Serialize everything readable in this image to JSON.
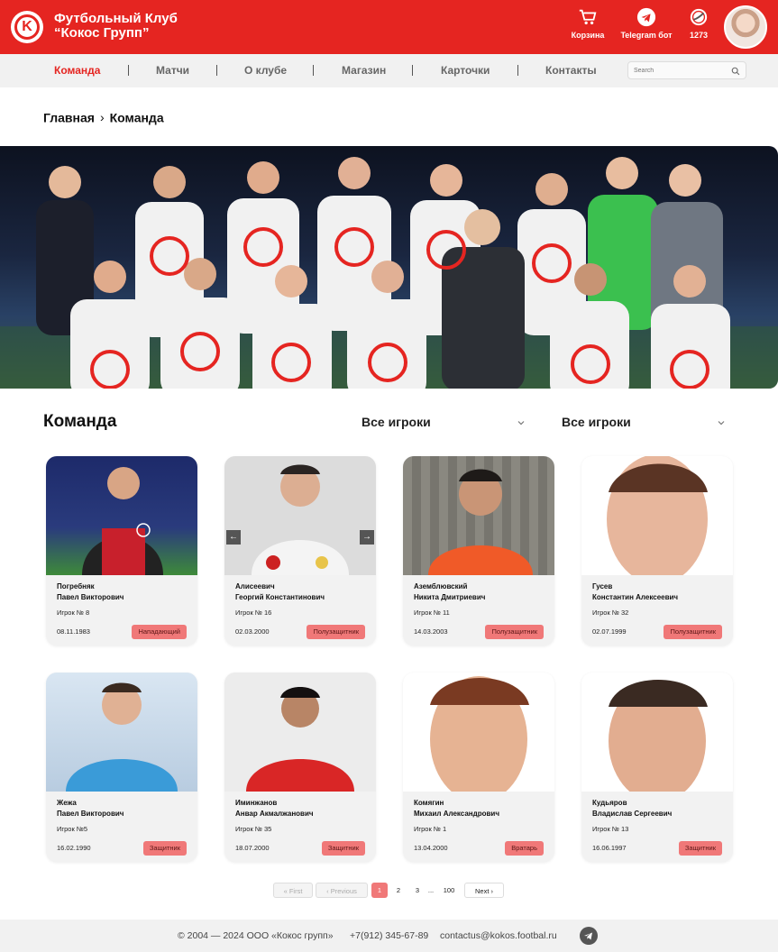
{
  "header": {
    "club_name": "Футбольный Клуб\n“Кокос Групп”",
    "logo_letter": "K",
    "cart_label": "Корзина",
    "telegram_label": "Telegram бот",
    "coins_label": "1273"
  },
  "nav": {
    "items": [
      "Команда",
      "Матчи",
      "О клубе",
      "Магазин",
      "Карточки",
      "Контакты"
    ],
    "search_placeholder": "Search"
  },
  "breadcrumb": {
    "home": "Главная",
    "current": "Команда"
  },
  "team": {
    "title": "Команда",
    "filter1": "Все игроки",
    "filter2": "Все игроки"
  },
  "players": [
    {
      "last": "Погребняк",
      "first": "Павел Викторович",
      "number": "Игрок № 8",
      "dob": "08.11.1983",
      "position": "Нападающий"
    },
    {
      "last": "Алисеевич",
      "first": "Георгий Константинович",
      "number": "Игрок № 16",
      "dob": "02.03.2000",
      "position": "Полузащитник"
    },
    {
      "last": "Аземблювский",
      "first": "Никита Дмитриевич",
      "number": "Игрок № 11",
      "dob": "14.03.2003",
      "position": "Полузащитник"
    },
    {
      "last": "Гусев",
      "first": "Константин Алексеевич",
      "number": "Игрок № 32",
      "dob": "02.07.1999",
      "position": "Полузащитник"
    },
    {
      "last": "Жежа",
      "first": "Павел Викторович",
      "number": "Игрок №5",
      "dob": "16.02.1990",
      "position": "Защитник"
    },
    {
      "last": "Иминжанов",
      "first": "Анвар Акмалжанович",
      "number": "Игрок № 35",
      "dob": "18.07.2000",
      "position": "Защитник"
    },
    {
      "last": "Комягин",
      "first": "Михаил Александрович",
      "number": "Игрок № 1",
      "dob": "13.04.2000",
      "position": "Вратарь"
    },
    {
      "last": "Кудьяров",
      "first": "Владислав Сергеевич",
      "number": "Игрок № 13",
      "dob": "16.06.1997",
      "position": "Защитник"
    }
  ],
  "pagination": {
    "first": "First",
    "previous": "Previous",
    "pages": [
      "1",
      "2",
      "3"
    ],
    "ellipsis": "...",
    "last_page": "100",
    "next": "Next",
    "current": "1"
  },
  "footer": {
    "copyright": "© 2004 — 2024 ООО «Кокос групп»",
    "phone": "+7(912) 345-67-89",
    "email": "contactus@kokos.footbal.ru"
  },
  "colors": {
    "brand_red": "#e52521",
    "position_badge": "#f07878"
  }
}
